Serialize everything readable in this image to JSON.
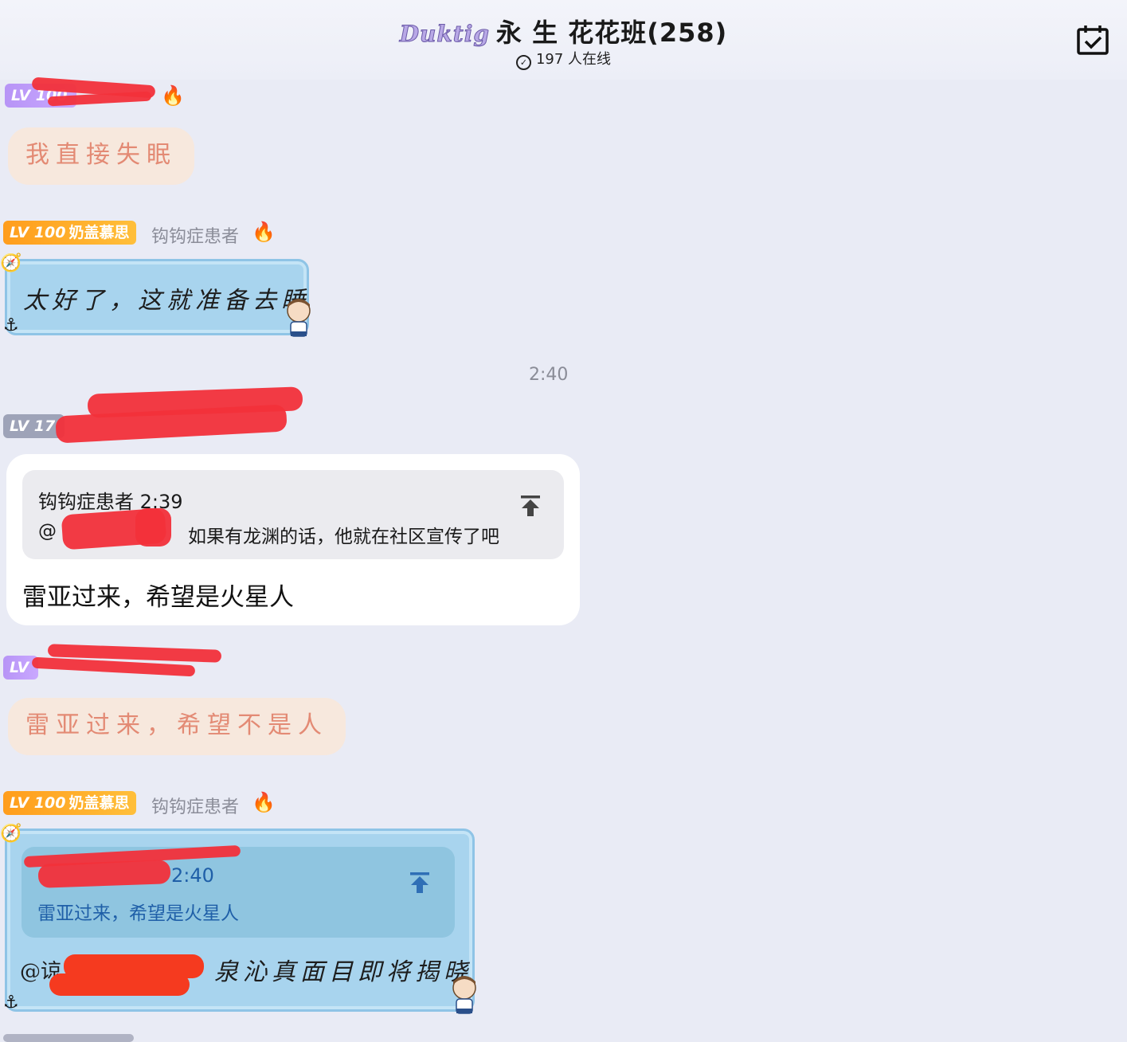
{
  "header": {
    "brand": "Duktig",
    "title": "永 生 花花班(258)",
    "online_icon": "✓",
    "online": "197 人在线",
    "calendar_icon": "calendar-check-icon"
  },
  "messages": [
    {
      "badge_level": "LV 100",
      "badge_title": "",
      "username": "",
      "text": "我直接失眠"
    },
    {
      "badge_level": "LV 100",
      "badge_title": "奶盖慕思",
      "username": "钩钩症患者",
      "text": "太好了，这就准备去睡"
    },
    {
      "time": "2:40"
    },
    {
      "badge_level": "LV 17",
      "quote_author_time": "钩钩症患者 2:39",
      "quote_prefix": "@",
      "quote_text": "如果有龙渊的话，他就在社区宣传了吧",
      "text": "雷亚过来，希望是火星人"
    },
    {
      "badge_level": "LV",
      "text": "雷亚过来，希望不是人"
    },
    {
      "badge_level": "LV 100",
      "badge_title": "奶盖慕思",
      "username": "钩钩症患者",
      "quote_time": "2:40",
      "quote_text": "雷亚过来，希望是火星人",
      "mention": "@谅",
      "text": "泉沁真面目即将揭晓"
    }
  ]
}
